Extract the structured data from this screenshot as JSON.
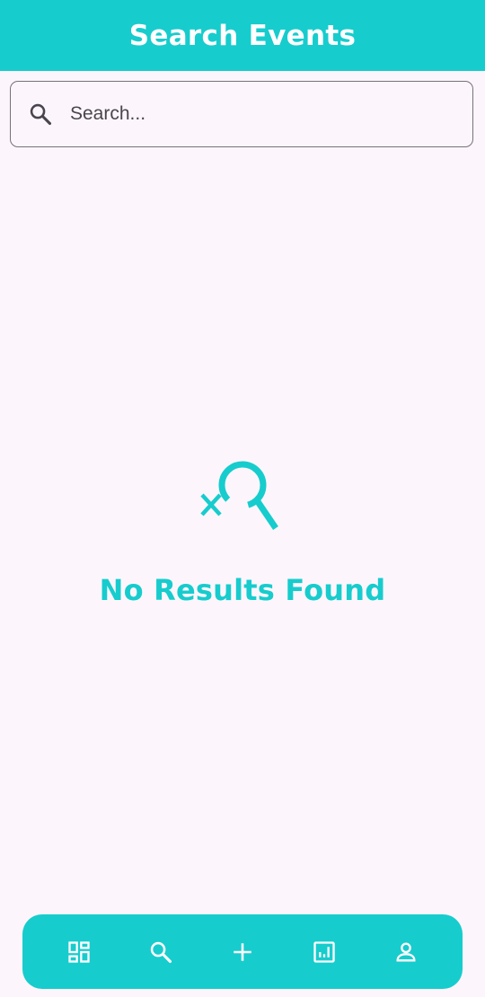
{
  "header": {
    "title": "Search Events"
  },
  "search": {
    "placeholder": "Search...",
    "value": "",
    "icon": "search-icon"
  },
  "empty_state": {
    "icon": "search-off-icon",
    "message": "No Results Found"
  },
  "bottom_nav": {
    "items": [
      {
        "icon": "dashboard-icon"
      },
      {
        "icon": "search-icon"
      },
      {
        "icon": "add-icon"
      },
      {
        "icon": "analytics-icon"
      },
      {
        "icon": "person-icon"
      }
    ]
  },
  "colors": {
    "accent": "#17cccd",
    "background": "#fcf6fc",
    "outline": "#77707a"
  }
}
